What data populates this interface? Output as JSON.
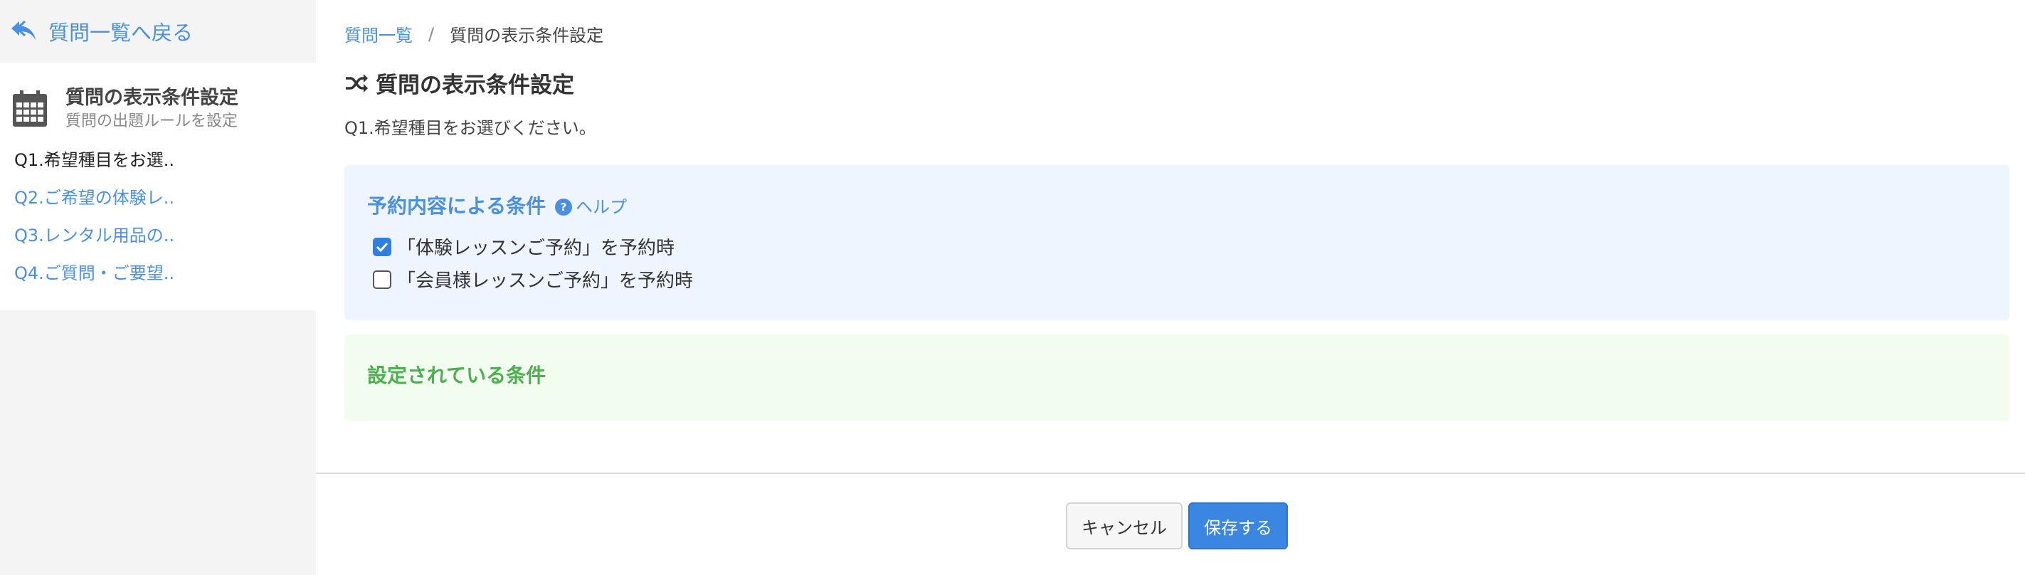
{
  "sidebar": {
    "back_label": "質問一覧へ戻る",
    "panel_title": "質問の表示条件設定",
    "panel_subtitle": "質問の出題ルールを設定",
    "questions": [
      {
        "label": "Q1.希望種目をお選.."
      },
      {
        "label": "Q2.ご希望の体験レ.."
      },
      {
        "label": "Q3.レンタル用品の.."
      },
      {
        "label": "Q4.ご質問・ご要望.."
      }
    ],
    "active_index": 0,
    "icons": {
      "back": "reply-arrow-icon",
      "panel": "calendar-icon"
    }
  },
  "breadcrumb": {
    "parent": "質問一覧",
    "separator": "/",
    "current": "質問の表示条件設定"
  },
  "main": {
    "title": "質問の表示条件設定",
    "title_icon": "shuffle-icon",
    "question_text": "Q1.希望種目をお選びください。",
    "conditions_section": {
      "title": "予約内容による条件",
      "help_label": "ヘルプ",
      "options": [
        {
          "label": "「体験レッスンご予約」を予約時",
          "checked": true
        },
        {
          "label": "「会員様レッスンご予約」を予約時",
          "checked": false
        }
      ]
    },
    "set_conditions_section": {
      "title": "設定されている条件"
    }
  },
  "footer": {
    "cancel_label": "キャンセル",
    "save_label": "保存する"
  },
  "colors": {
    "accent": "#4a90e2",
    "conditions_bg": "#eef5fe",
    "set_conditions_bg": "#f2fcef",
    "set_conditions_title": "#4caf50",
    "save_button": "#3b86e0",
    "sidebar_bg": "#f4f4f4"
  }
}
